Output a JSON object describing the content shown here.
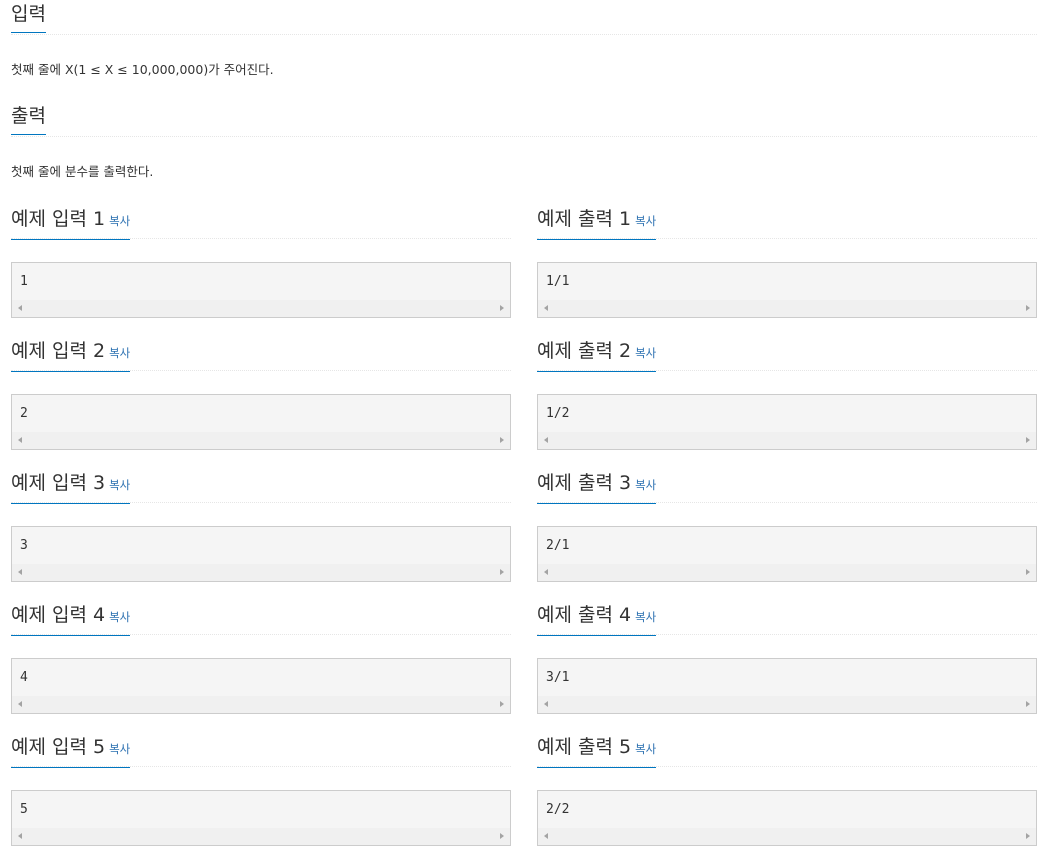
{
  "input_section": {
    "title": "입력",
    "description": "첫째 줄에 X(1 ≤ X ≤ 10,000,000)가 주어진다."
  },
  "output_section": {
    "title": "출력",
    "description": "첫째 줄에 분수를 출력한다."
  },
  "copy_label": "복사",
  "samples": [
    {
      "input_title": "예제 입력 1",
      "input": "1",
      "output_title": "예제 출력 1",
      "output": "1/1"
    },
    {
      "input_title": "예제 입력 2",
      "input": "2",
      "output_title": "예제 출력 2",
      "output": "1/2"
    },
    {
      "input_title": "예제 입력 3",
      "input": "3",
      "output_title": "예제 출력 3",
      "output": "2/1"
    },
    {
      "input_title": "예제 입력 4",
      "input": "4",
      "output_title": "예제 출력 4",
      "output": "3/1"
    },
    {
      "input_title": "예제 입력 5",
      "input": "5",
      "output_title": "예제 출력 5",
      "output": "2/2"
    }
  ],
  "colors": {
    "accent": "#0076c0",
    "link": "#2a6fb0",
    "pre_background": "#f5f5f5",
    "pre_border": "#cccccc"
  }
}
